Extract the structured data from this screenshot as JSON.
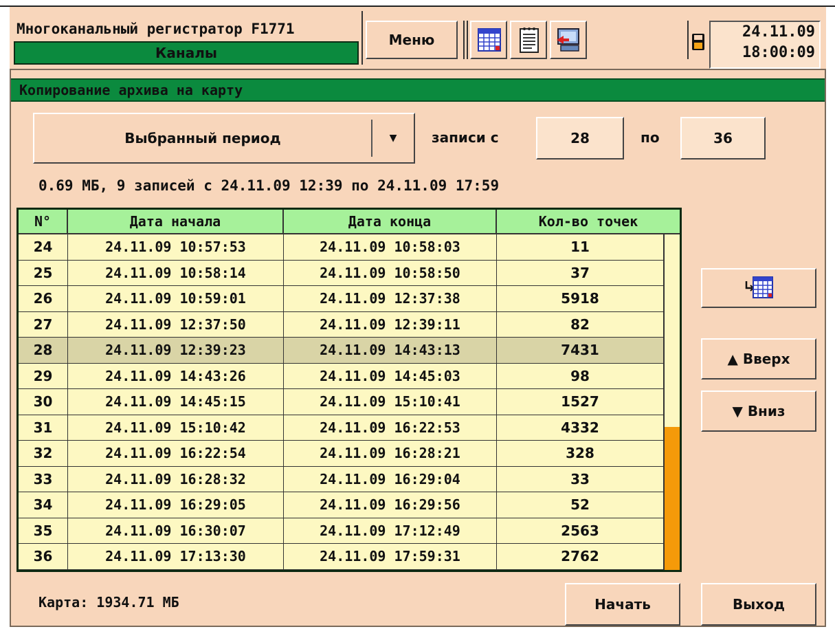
{
  "header": {
    "title": "Многоканальный регистратор F1771",
    "subtitle": "Каналы",
    "menu_label": "Меню",
    "date": "24.11.09",
    "time": "18:00:09",
    "icons": [
      "table-icon",
      "notepad-icon",
      "computer-icon",
      "floppy-icon"
    ]
  },
  "panel": {
    "title": "Копирование архива на карту",
    "period_selector": "Выбранный период",
    "records_from_label": "записи с",
    "records_from": "28",
    "records_to_label": "по",
    "records_to": "36",
    "summary": "0.69 МБ, 9 записей с 24.11.09 12:39 по 24.11.09 17:59"
  },
  "table": {
    "columns": [
      "N°",
      "Дата начала",
      "Дата конца",
      "Кол-во точек"
    ],
    "selected_index": 4,
    "rows": [
      {
        "n": "24",
        "start": "24.11.09 10:57:53",
        "end": "24.11.09 10:58:03",
        "points": "11"
      },
      {
        "n": "25",
        "start": "24.11.09 10:58:14",
        "end": "24.11.09 10:58:50",
        "points": "37"
      },
      {
        "n": "26",
        "start": "24.11.09 10:59:01",
        "end": "24.11.09 12:37:38",
        "points": "5918"
      },
      {
        "n": "27",
        "start": "24.11.09 12:37:50",
        "end": "24.11.09 12:39:11",
        "points": "82"
      },
      {
        "n": "28",
        "start": "24.11.09 12:39:23",
        "end": "24.11.09 14:43:13",
        "points": "7431"
      },
      {
        "n": "29",
        "start": "24.11.09 14:43:26",
        "end": "24.11.09 14:45:03",
        "points": "98"
      },
      {
        "n": "30",
        "start": "24.11.09 14:45:15",
        "end": "24.11.09 15:10:41",
        "points": "1527"
      },
      {
        "n": "31",
        "start": "24.11.09 15:10:42",
        "end": "24.11.09 16:22:53",
        "points": "4332"
      },
      {
        "n": "32",
        "start": "24.11.09 16:22:54",
        "end": "24.11.09 16:28:21",
        "points": "328"
      },
      {
        "n": "33",
        "start": "24.11.09 16:28:32",
        "end": "24.11.09 16:29:04",
        "points": "33"
      },
      {
        "n": "34",
        "start": "24.11.09 16:29:05",
        "end": "24.11.09 16:29:56",
        "points": "52"
      },
      {
        "n": "35",
        "start": "24.11.09 16:30:07",
        "end": "24.11.09 17:12:49",
        "points": "2563"
      },
      {
        "n": "36",
        "start": "24.11.09 17:13:30",
        "end": "24.11.09 17:59:31",
        "points": "2762"
      }
    ]
  },
  "side": {
    "up_label": "▲ Вверх",
    "down_label": "▼ Вниз"
  },
  "footer": {
    "card_info": "Карта: 1934.71 МБ",
    "start_label": "Начать",
    "exit_label": "Выход"
  },
  "colors": {
    "background": "#f8d6bb",
    "title_bar": "#0b8a3e",
    "table_body": "#fdf8c2",
    "table_header": "#a6f19a",
    "selected_row": "#d9d4a6",
    "scroll_thumb": "#f59a09"
  }
}
